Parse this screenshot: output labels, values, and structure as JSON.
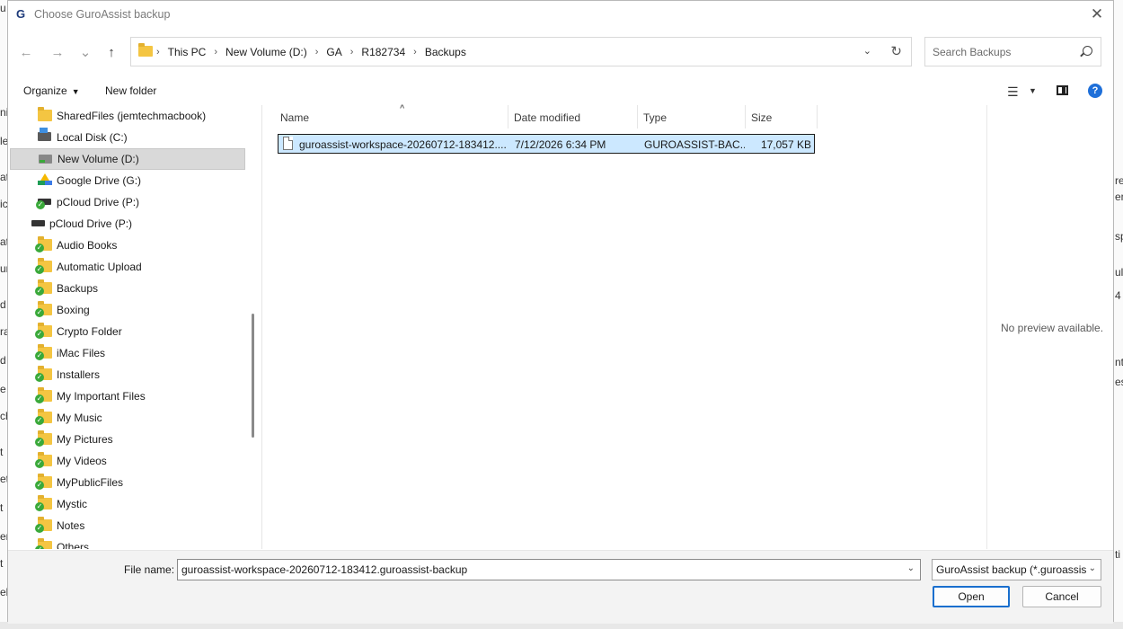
{
  "window": {
    "title": "Choose GuroAssist backup",
    "app_icon_letter": "G"
  },
  "nav": {
    "back": "←",
    "forward": "→",
    "recent": "⌄",
    "up": "↑"
  },
  "address": {
    "crumbs": [
      "This PC",
      "New Volume (D:)",
      "GA",
      "R182734",
      "Backups"
    ],
    "dropdown": "⌄",
    "refresh": "↻"
  },
  "search": {
    "placeholder": "Search Backups"
  },
  "toolbar": {
    "organize": "Organize",
    "new_folder": "New folder"
  },
  "navpane": {
    "items": [
      {
        "label": "SharedFiles (jemtechmacbook)",
        "icon": "folder-icon"
      },
      {
        "label": "Local Disk (C:)",
        "icon": "windows-drive-icon"
      },
      {
        "label": "New Volume (D:)",
        "icon": "drive-icon",
        "selected": true
      },
      {
        "label": "Google Drive (G:)",
        "icon": "google-drive-icon"
      },
      {
        "label": "pCloud Drive (P:)",
        "icon": "pcloud-drive-icon"
      },
      {
        "label": "pCloud Drive (P:)",
        "icon": "pcloud-drive-icon"
      },
      {
        "label": "Audio Books",
        "icon": "synced-folder-icon"
      },
      {
        "label": "Automatic Upload",
        "icon": "synced-folder-icon"
      },
      {
        "label": "Backups",
        "icon": "synced-folder-icon"
      },
      {
        "label": "Boxing",
        "icon": "synced-folder-icon"
      },
      {
        "label": "Crypto Folder",
        "icon": "synced-folder-icon"
      },
      {
        "label": "iMac Files",
        "icon": "synced-folder-icon"
      },
      {
        "label": "Installers",
        "icon": "synced-folder-icon"
      },
      {
        "label": "My Important Files",
        "icon": "synced-folder-icon"
      },
      {
        "label": "My Music",
        "icon": "synced-folder-icon"
      },
      {
        "label": "My Pictures",
        "icon": "synced-folder-icon"
      },
      {
        "label": "My Videos",
        "icon": "synced-folder-icon"
      },
      {
        "label": "MyPublicFiles",
        "icon": "synced-folder-icon"
      },
      {
        "label": "Mystic",
        "icon": "synced-folder-icon"
      },
      {
        "label": "Notes",
        "icon": "synced-folder-icon"
      },
      {
        "label": "Others",
        "icon": "synced-folder-icon"
      }
    ]
  },
  "filelist": {
    "columns": [
      "Name",
      "Date modified",
      "Type",
      "Size"
    ],
    "rows": [
      {
        "name": "guroassist-workspace-20260712-183412....",
        "date": "7/12/2026 6:34 PM",
        "type": "GUROASSIST-BAC...",
        "size": "17,057 KB"
      }
    ]
  },
  "preview": {
    "text": "No preview available."
  },
  "footer": {
    "file_name_label": "File name:",
    "file_name_value": "guroassist-workspace-20260712-183412.guroassist-backup",
    "file_type": "GuroAssist backup (*.guroassist",
    "open": "Open",
    "cancel": "Cancel"
  },
  "background": {
    "left_fragments": [
      "u",
      "ni",
      "le",
      "at",
      "ic",
      "at",
      "ur",
      "d",
      "ra",
      "d",
      "e",
      "ch",
      "t",
      "et",
      "t",
      "er",
      "t",
      "el"
    ],
    "right_fragments": [
      "re",
      "en",
      "sp",
      "ul",
      "4",
      "nt",
      "es",
      "ti"
    ]
  },
  "colors": {
    "accent": "#1a6fce",
    "selection": "#cce8ff",
    "folder": "#f4c542",
    "sync_check": "#3aa93a"
  }
}
